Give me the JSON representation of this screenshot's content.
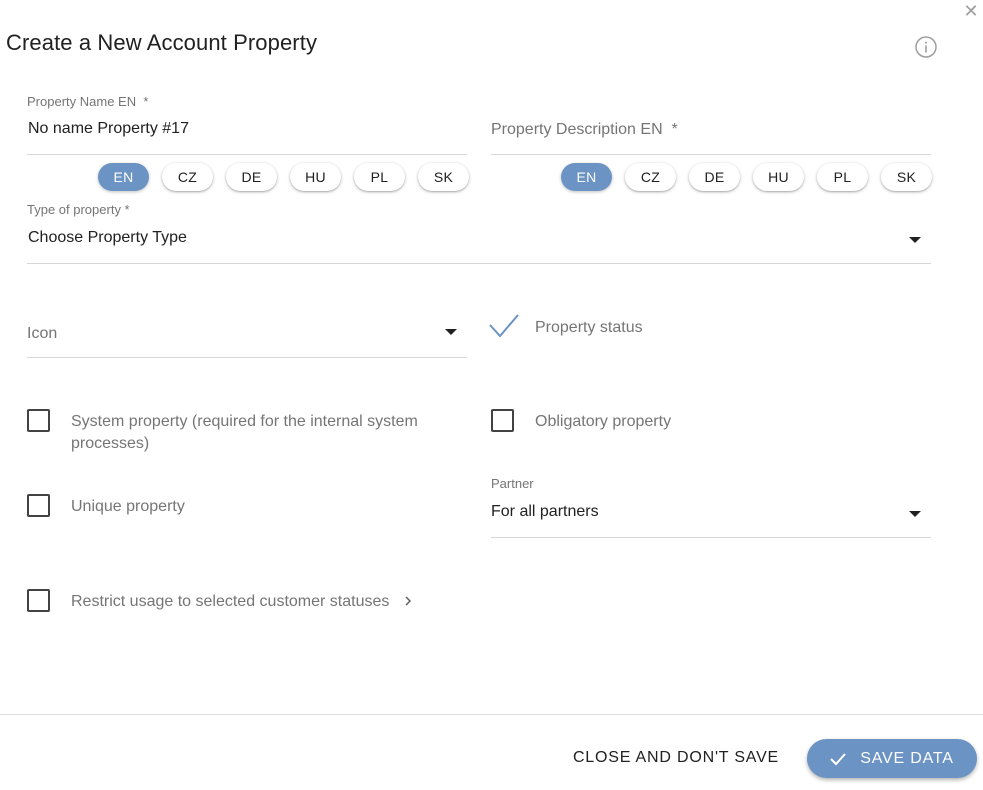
{
  "dialog": {
    "title": "Create a New Account Property",
    "close_icon": "close-icon",
    "info_icon": "info-icon"
  },
  "property_name": {
    "label": "Property Name EN",
    "required_mark": "*",
    "value": "No name Property #17",
    "languages": [
      "EN",
      "CZ",
      "DE",
      "HU",
      "PL",
      "SK"
    ],
    "active_language": "EN"
  },
  "property_description": {
    "placeholder": "Property Description EN",
    "required_mark": "*",
    "value": "",
    "languages": [
      "EN",
      "CZ",
      "DE",
      "HU",
      "PL",
      "SK"
    ],
    "active_language": "EN"
  },
  "property_type": {
    "label": "Type of property *",
    "value": "Choose Property Type"
  },
  "icon_select": {
    "placeholder": "Icon",
    "value": ""
  },
  "property_status": {
    "label": "Property status",
    "checked": true
  },
  "system_property": {
    "label": "System property (required for the internal system processes)",
    "checked": false
  },
  "obligatory_property": {
    "label": "Obligatory property",
    "checked": false
  },
  "unique_property": {
    "label": "Unique property",
    "checked": false
  },
  "partner": {
    "label": "Partner",
    "value": "For all partners"
  },
  "restrict_usage": {
    "label": "Restrict usage to selected customer statuses",
    "checked": false
  },
  "footer": {
    "close_label": "CLOSE AND DON'T SAVE",
    "save_label": "SAVE DATA"
  },
  "colors": {
    "accent": "#6b93c4",
    "text": "#212121",
    "muted": "#757575",
    "divider": "#e0e0e0"
  }
}
